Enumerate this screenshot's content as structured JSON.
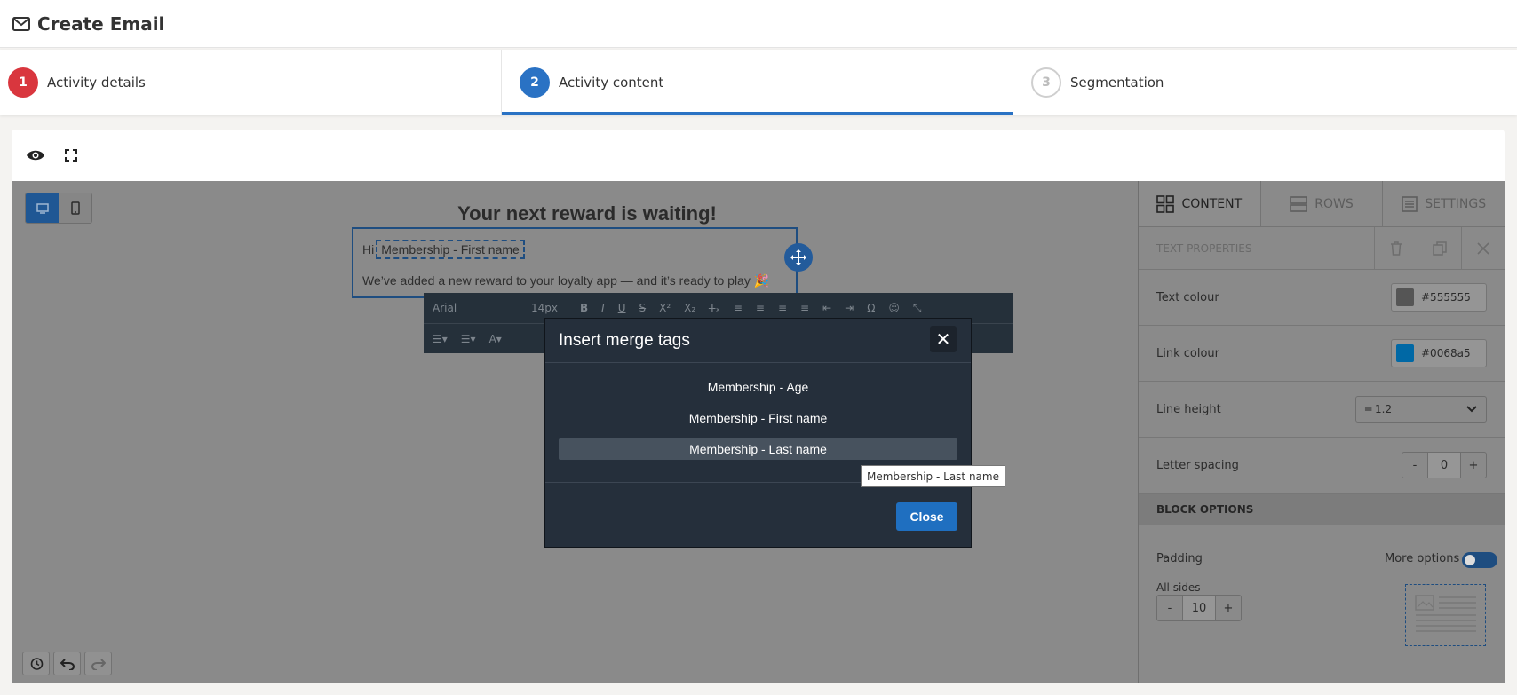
{
  "header": {
    "title": "Create Email"
  },
  "steps": [
    {
      "num": "1",
      "label": "Activity details"
    },
    {
      "num": "2",
      "label": "Activity content"
    },
    {
      "num": "3",
      "label": "Segmentation"
    }
  ],
  "email": {
    "headline": "Your next reward is waiting!",
    "greeting": "Hi",
    "merge_tag": "Membership - First name",
    "body": "We’ve added a new reward to your loyalty app — and it’s ready to play 🎉"
  },
  "rte": {
    "font": "Arial",
    "size": "14px"
  },
  "panel": {
    "tabs": [
      "CONTENT",
      "ROWS",
      "SETTINGS"
    ],
    "section_title": "TEXT PROPERTIES",
    "text_colour": {
      "label": "Text colour",
      "value": "#555555",
      "swatch": "#555555"
    },
    "link_colour": {
      "label": "Link colour",
      "value": "#0068a5",
      "swatch": "#0068a5"
    },
    "line_height": {
      "label": "Line height",
      "value": "1.2"
    },
    "letter_spacing": {
      "label": "Letter spacing",
      "value": "0"
    },
    "block_options": "BLOCK OPTIONS",
    "padding": {
      "label": "Padding",
      "more": "More options",
      "all_sides": "All sides",
      "value": "10"
    }
  },
  "modal": {
    "title": "Insert merge tags",
    "items": [
      "Membership - Age",
      "Membership - First name",
      "Membership - Last name"
    ],
    "close": "Close",
    "tooltip": "Membership - Last name"
  },
  "colors": {
    "accent": "#2a72c4",
    "step_done": "#d9363e",
    "modal_bg": "#252f3b"
  }
}
